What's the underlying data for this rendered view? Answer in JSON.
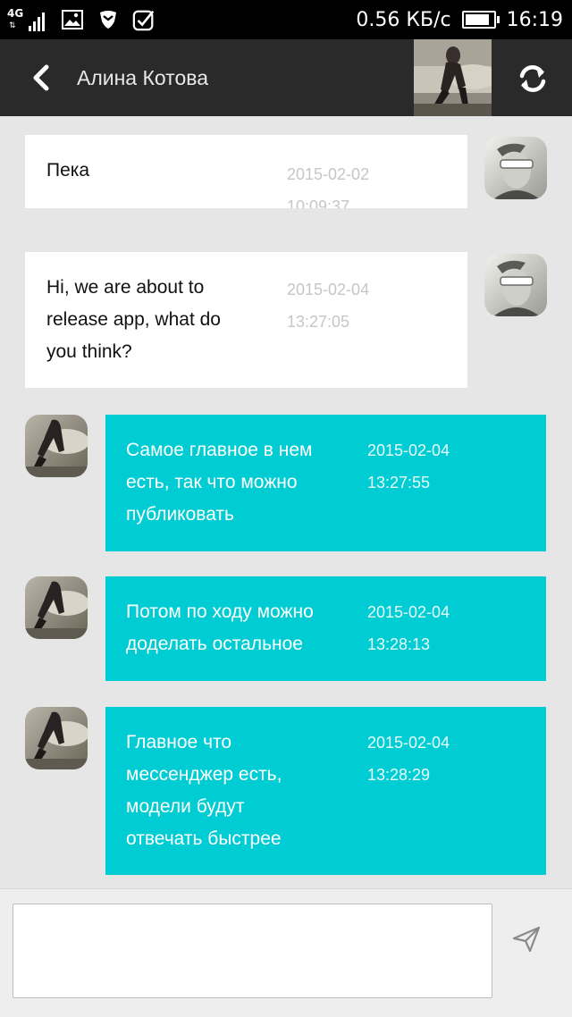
{
  "status_bar": {
    "network_type": "4G",
    "speed": "0.56 КБ/с",
    "time": "16:19",
    "battery_level": 0.85,
    "icons": [
      "signal-icon",
      "gallery-icon",
      "shield-icon",
      "check-icon",
      "battery-icon"
    ]
  },
  "header": {
    "contact_name": "Алина Котова",
    "back_icon": "chevron-left-icon",
    "refresh_icon": "refresh-icon"
  },
  "messages": [
    {
      "direction": "incoming",
      "text": "Пека",
      "date": "2015-02-02",
      "time": "10:09:37"
    },
    {
      "direction": "incoming",
      "text": "Hi, we are about to\nrelease app, what do\nyou think?",
      "date": "2015-02-04",
      "time": "13:27:05"
    },
    {
      "direction": "outgoing",
      "text": "Самое главное в нем\nесть, так что можно\nпубликовать",
      "date": "2015-02-04",
      "time": "13:27:55"
    },
    {
      "direction": "outgoing",
      "text": "Потом по ходу можно\nдоделать остальное",
      "date": "2015-02-04",
      "time": "13:28:13"
    },
    {
      "direction": "outgoing",
      "text": "Главное что\nмессенджер есть,\nмодели будут\nотвечать быстрее",
      "date": "2015-02-04",
      "time": "13:28:29"
    }
  ],
  "composer": {
    "input_value": "",
    "send_icon": "send-icon"
  },
  "colors": {
    "outgoing_bubble": "#00cdd3",
    "incoming_bubble": "#ffffff",
    "app_bar": "#2a2a2a",
    "background": "#e6e6e6"
  }
}
